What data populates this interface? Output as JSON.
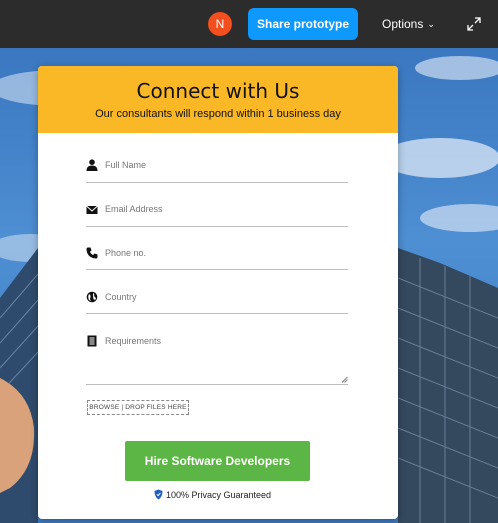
{
  "toolbar": {
    "avatar_initial": "N",
    "share_label": "Share prototype",
    "options_label": "Options",
    "accent": "#0d99ff"
  },
  "form": {
    "title": "Connect with Us",
    "subtitle": "Our consultants will respond within 1 business day",
    "fields": [
      {
        "placeholder": "Full Name",
        "icon": "user-icon"
      },
      {
        "placeholder": "Email Address",
        "icon": "envelope-icon"
      },
      {
        "placeholder": "Phone no.",
        "icon": "phone-icon"
      },
      {
        "placeholder": "Country",
        "icon": "globe-icon"
      },
      {
        "placeholder": "Requirements",
        "icon": "document-icon"
      }
    ],
    "browse_label": "BROWSE | DROP FILES HERE",
    "submit_label": "Hire Software Developers",
    "privacy_label": "100% Privacy Guaranteed",
    "header_color": "#fbb826",
    "button_color": "#5cb645"
  }
}
